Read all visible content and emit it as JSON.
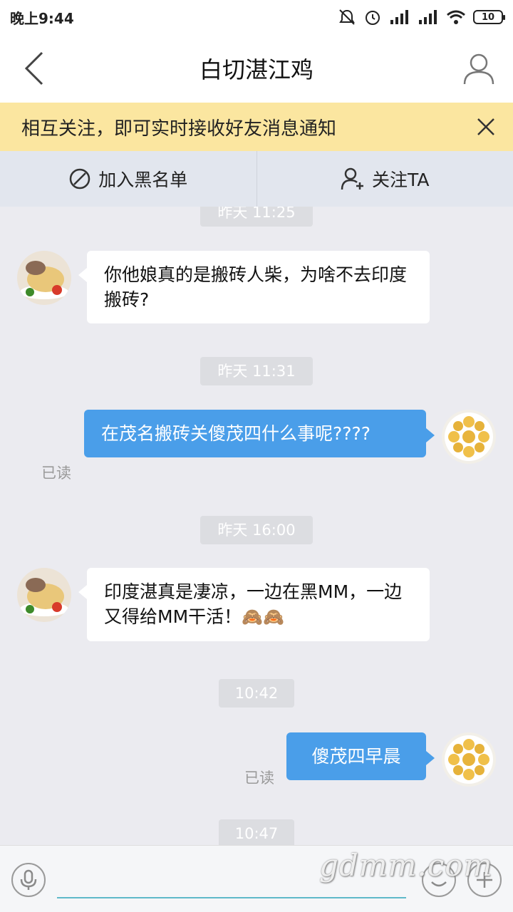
{
  "status_bar": {
    "time": "晚上9:44",
    "battery": "10"
  },
  "header": {
    "title": "白切湛江鸡"
  },
  "notice": {
    "text": "相互关注，即可实时接收好友消息通知"
  },
  "actions": {
    "blacklist_label": "加入黑名单",
    "follow_label": "关注TA"
  },
  "chat": {
    "time_1": "昨天 11:25",
    "msg_1": "你他娘真的是搬砖人柴，为啥不去印度搬砖?",
    "time_2": "昨天 11:31",
    "msg_2": "在茂名搬砖关傻茂四什么事呢????",
    "read_2": "已读",
    "time_3": "昨天 16:00",
    "msg_3": "印度湛真是凄凉，一边在黑MM，一边又得给MM干活！",
    "msg_3_emoji": "🙈🙈",
    "time_4": "10:42",
    "msg_4": "傻茂四早晨",
    "read_4": "已读",
    "time_5": "10:47"
  },
  "input": {
    "placeholder": ""
  },
  "watermark": "gdmm.com",
  "colors": {
    "accent_blue": "#4a9ee9",
    "notice_bg": "#fbe6a0",
    "chat_bg": "#ebebf0"
  },
  "icons": [
    "back-arrow-icon",
    "profile-icon",
    "close-icon",
    "block-icon",
    "add-user-icon",
    "mic-icon",
    "emoji-icon",
    "plus-icon"
  ]
}
